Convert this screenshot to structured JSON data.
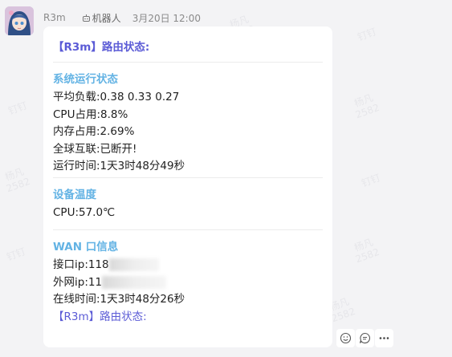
{
  "watermarks": [
    {
      "text": "杨凡\n2582"
    },
    {
      "text": "钉钉"
    },
    {
      "text": "杨凡\n2582"
    },
    {
      "text": "钉钉"
    },
    {
      "text": "杨凡\n2582"
    },
    {
      "text": "钉钉"
    },
    {
      "text": "杨凡\n2582"
    },
    {
      "text": "钉钉"
    },
    {
      "text": "杨凡\n2582"
    }
  ],
  "message": {
    "sender": "R3m",
    "bot_tag": "机器人",
    "timestamp": "3月20日 12:00",
    "title": "【R3m】路由状态:",
    "system": {
      "title": "系统运行状态",
      "lines": [
        "平均负载:0.38 0.33 0.27",
        "CPU占用:8.8%",
        "内存占用:2.69%",
        "全球互联:已断开!",
        "运行时间:1天3时48分49秒"
      ]
    },
    "temperature": {
      "title": "设备温度",
      "lines": [
        "CPU:57.0℃"
      ]
    },
    "wan": {
      "title": "WAN 口信息",
      "iface_prefix": "接口ip:118",
      "public_prefix": "外网ip:11",
      "online": "在线时间:1天3时48分26秒"
    },
    "footer": "【R3m】路由状态:"
  },
  "actions": [
    {
      "icon": "emoji-icon"
    },
    {
      "icon": "reply-icon"
    },
    {
      "icon": "more-icon"
    }
  ]
}
